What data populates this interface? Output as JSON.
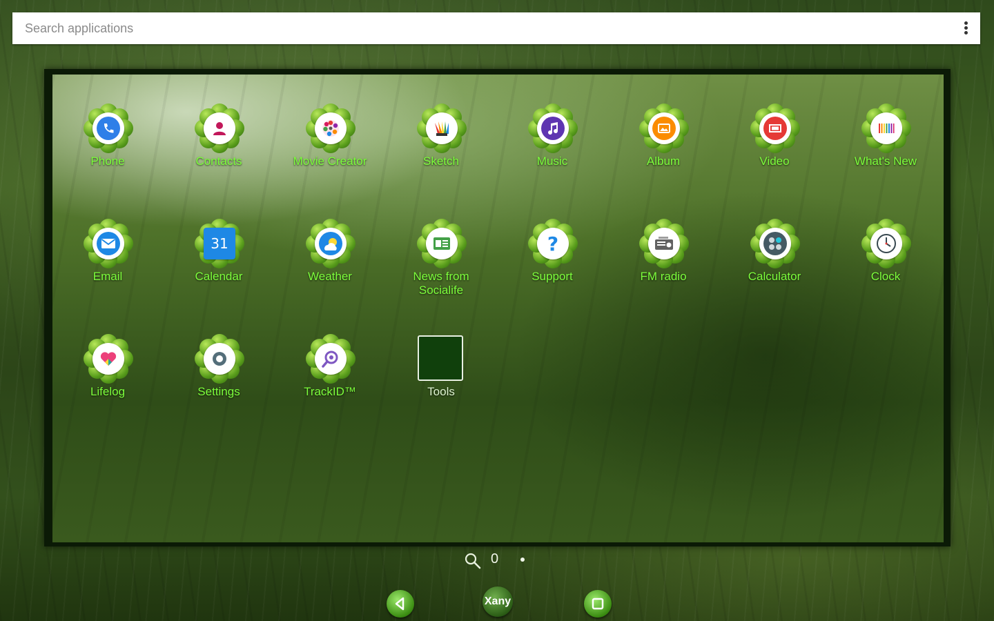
{
  "search": {
    "placeholder": "Search applications",
    "menu_icon": "more-vertical-icon"
  },
  "apps": [
    {
      "label": "Phone",
      "icon": "phone-icon",
      "color": "#2f7fe8"
    },
    {
      "label": "Contacts",
      "icon": "person-icon",
      "color": "#c2185b"
    },
    {
      "label": "Movie Creator",
      "icon": "film-reel-icon",
      "color": "#e53935"
    },
    {
      "label": "Sketch",
      "icon": "palette-icon",
      "color": "#ff9800"
    },
    {
      "label": "Music",
      "icon": "music-note-icon",
      "color": "#5e35b1"
    },
    {
      "label": "Album",
      "icon": "picture-icon",
      "color": "#fb8c00"
    },
    {
      "label": "Video",
      "icon": "video-icon",
      "color": "#e53935"
    },
    {
      "label": "What's New",
      "icon": "barcode-icon",
      "color": "#26a69a"
    },
    {
      "label": "Email",
      "icon": "envelope-icon",
      "color": "#1e88e5"
    },
    {
      "label": "Calendar",
      "icon": "calendar-icon",
      "color": "#1e88e5"
    },
    {
      "label": "Weather",
      "icon": "weather-icon",
      "color": "#1e88e5"
    },
    {
      "label": "News from Socialife",
      "icon": "news-icon",
      "color": "#43a047"
    },
    {
      "label": "Support",
      "icon": "question-icon",
      "color": "#1e88e5"
    },
    {
      "label": "FM radio",
      "icon": "radio-icon",
      "color": "#616161"
    },
    {
      "label": "Calculator",
      "icon": "calculator-icon",
      "color": "#455a64"
    },
    {
      "label": "Clock",
      "icon": "clock-icon",
      "color": "#37474f"
    },
    {
      "label": "Lifelog",
      "icon": "heart-icon",
      "color": "#ec407a"
    },
    {
      "label": "Settings",
      "icon": "gear-icon",
      "color": "#546e7a"
    },
    {
      "label": "TrackID™",
      "icon": "trackid-icon",
      "color": "#7e57c2"
    },
    {
      "label": "Tools",
      "icon": "folder-icon",
      "color": "#10400c"
    }
  ],
  "calendar_day": "31",
  "page_indicator": {
    "search_icon": "search-icon",
    "current": "0"
  },
  "dock": {
    "back_icon": "back-arrow-icon",
    "home_label": "Xany",
    "recent_icon": "recent-apps-icon"
  },
  "colors": {
    "label_green": "#7dff3c",
    "petal_green": "#5a9e1c",
    "panel_border": "#0b1a06"
  }
}
